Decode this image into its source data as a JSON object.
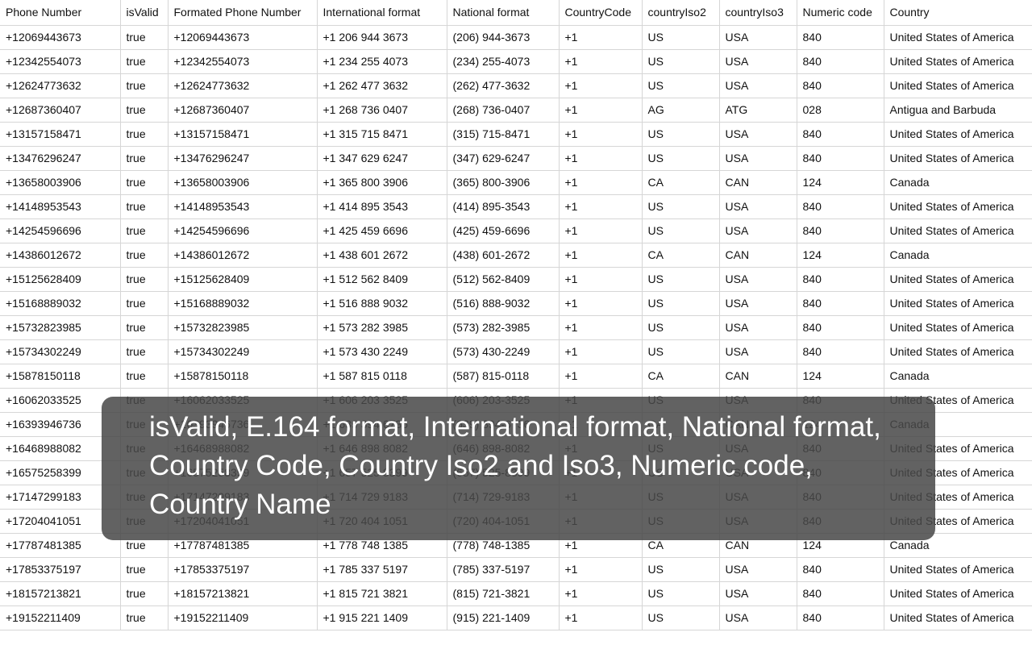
{
  "table": {
    "headers": [
      "Phone Number",
      "isValid",
      "Formated Phone Number",
      "International format",
      "National format",
      "CountryCode",
      "countryIso2",
      "countryIso3",
      "Numeric code",
      "Country"
    ],
    "rows": [
      [
        "+12069443673",
        "true",
        "+12069443673",
        "+1 206 944 3673",
        "(206) 944-3673",
        "+1",
        "US",
        "USA",
        "840",
        "United States of America"
      ],
      [
        "+12342554073",
        "true",
        "+12342554073",
        "+1 234 255 4073",
        "(234) 255-4073",
        "+1",
        "US",
        "USA",
        "840",
        "United States of America"
      ],
      [
        "+12624773632",
        "true",
        "+12624773632",
        "+1 262 477 3632",
        "(262) 477-3632",
        "+1",
        "US",
        "USA",
        "840",
        "United States of America"
      ],
      [
        "+12687360407",
        "true",
        "+12687360407",
        "+1 268 736 0407",
        "(268) 736-0407",
        "+1",
        "AG",
        "ATG",
        "028",
        "Antigua and Barbuda"
      ],
      [
        "+13157158471",
        "true",
        "+13157158471",
        "+1 315 715 8471",
        "(315) 715-8471",
        "+1",
        "US",
        "USA",
        "840",
        "United States of America"
      ],
      [
        "+13476296247",
        "true",
        "+13476296247",
        "+1 347 629 6247",
        "(347) 629-6247",
        "+1",
        "US",
        "USA",
        "840",
        "United States of America"
      ],
      [
        "+13658003906",
        "true",
        "+13658003906",
        "+1 365 800 3906",
        "(365) 800-3906",
        "+1",
        "CA",
        "CAN",
        "124",
        "Canada"
      ],
      [
        "+14148953543",
        "true",
        "+14148953543",
        "+1 414 895 3543",
        "(414) 895-3543",
        "+1",
        "US",
        "USA",
        "840",
        "United States of America"
      ],
      [
        "+14254596696",
        "true",
        "+14254596696",
        "+1 425 459 6696",
        "(425) 459-6696",
        "+1",
        "US",
        "USA",
        "840",
        "United States of America"
      ],
      [
        "+14386012672",
        "true",
        "+14386012672",
        "+1 438 601 2672",
        "(438) 601-2672",
        "+1",
        "CA",
        "CAN",
        "124",
        "Canada"
      ],
      [
        "+15125628409",
        "true",
        "+15125628409",
        "+1 512 562 8409",
        "(512) 562-8409",
        "+1",
        "US",
        "USA",
        "840",
        "United States of America"
      ],
      [
        "+15168889032",
        "true",
        "+15168889032",
        "+1 516 888 9032",
        "(516) 888-9032",
        "+1",
        "US",
        "USA",
        "840",
        "United States of America"
      ],
      [
        "+15732823985",
        "true",
        "+15732823985",
        "+1 573 282 3985",
        "(573) 282-3985",
        "+1",
        "US",
        "USA",
        "840",
        "United States of America"
      ],
      [
        "+15734302249",
        "true",
        "+15734302249",
        "+1 573 430 2249",
        "(573) 430-2249",
        "+1",
        "US",
        "USA",
        "840",
        "United States of America"
      ],
      [
        "+15878150118",
        "true",
        "+15878150118",
        "+1 587 815 0118",
        "(587) 815-0118",
        "+1",
        "CA",
        "CAN",
        "124",
        "Canada"
      ],
      [
        "+16062033525",
        "true",
        "+16062033525",
        "+1 606 203 3525",
        "(606) 203-3525",
        "+1",
        "US",
        "USA",
        "840",
        "United States of America"
      ],
      [
        "+16393946736",
        "true",
        "+16393946736",
        "+1 639 394 6736",
        "(639) 394-6736",
        "+1",
        "CA",
        "CAN",
        "124",
        "Canada"
      ],
      [
        "+16468988082",
        "true",
        "+16468988082",
        "+1 646 898 8082",
        "(646) 898-8082",
        "+1",
        "US",
        "USA",
        "840",
        "United States of America"
      ],
      [
        "+16575258399",
        "true",
        "+16575258399",
        "+1 657 525 8399",
        "(657) 525-8399",
        "+1",
        "US",
        "USA",
        "840",
        "United States of America"
      ],
      [
        "+17147299183",
        "true",
        "+17147299183",
        "+1 714 729 9183",
        "(714) 729-9183",
        "+1",
        "US",
        "USA",
        "840",
        "United States of America"
      ],
      [
        "+17204041051",
        "true",
        "+17204041051",
        "+1 720 404 1051",
        "(720) 404-1051",
        "+1",
        "US",
        "USA",
        "840",
        "United States of America"
      ],
      [
        "+17787481385",
        "true",
        "+17787481385",
        "+1 778 748 1385",
        "(778) 748-1385",
        "+1",
        "CA",
        "CAN",
        "124",
        "Canada"
      ],
      [
        "+17853375197",
        "true",
        "+17853375197",
        "+1 785 337 5197",
        "(785) 337-5197",
        "+1",
        "US",
        "USA",
        "840",
        "United States of America"
      ],
      [
        "+18157213821",
        "true",
        "+18157213821",
        "+1 815 721 3821",
        "(815) 721-3821",
        "+1",
        "US",
        "USA",
        "840",
        "United States of America"
      ],
      [
        "+19152211409",
        "true",
        "+19152211409",
        "+1 915 221 1409",
        "(915) 221-1409",
        "+1",
        "US",
        "USA",
        "840",
        "United States of America"
      ]
    ]
  },
  "overlay": {
    "text": "isValid, E.164 format, International format, National format, Country Code, Country Iso2 and Iso3, Numeric code, Country Name"
  }
}
